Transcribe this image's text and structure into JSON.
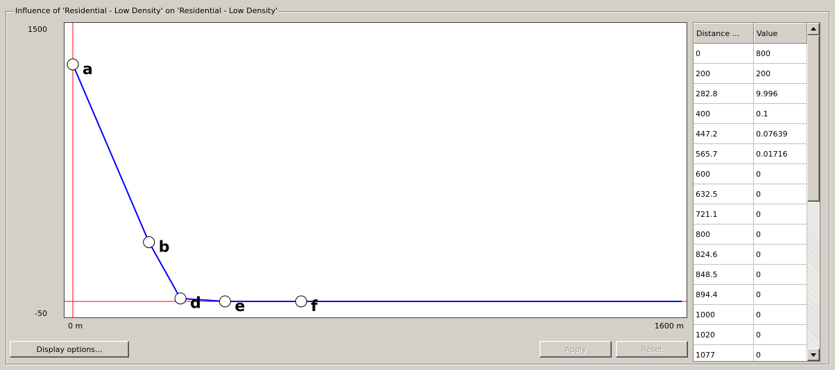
{
  "group_title": "Influence of 'Residential - Low Density' on 'Residential - Low Density'",
  "chart": {
    "y_max_label": "1500",
    "y_min_label": "-50",
    "x_min_label": "0 m",
    "x_max_label": "1600 m",
    "ylim": [
      -50,
      1500
    ],
    "xlim": [
      0,
      1600
    ],
    "line_color": "#0000ff",
    "axis_color": "#ff0000"
  },
  "chart_data": {
    "type": "line",
    "x": [
      0,
      200,
      282.8,
      400,
      600,
      1600
    ],
    "values": [
      800,
      200,
      9.996,
      0.1,
      0,
      0
    ],
    "point_labels": [
      "a",
      "b",
      "d",
      "e",
      "f"
    ],
    "ylim": [
      -50,
      1500
    ],
    "xlim": [
      0,
      1600
    ]
  },
  "buttons": {
    "display_options": "Display options...",
    "apply": "Apply",
    "reset": "Reset"
  },
  "table": {
    "headers": [
      "Distance ...",
      "Value"
    ],
    "rows": [
      [
        "0",
        "800"
      ],
      [
        "200",
        "200"
      ],
      [
        "282.8",
        "9.996"
      ],
      [
        "400",
        "0.1"
      ],
      [
        "447.2",
        "0.07639"
      ],
      [
        "565.7",
        "0.01716"
      ],
      [
        "600",
        "0"
      ],
      [
        "632.5",
        "0"
      ],
      [
        "721.1",
        "0"
      ],
      [
        "800",
        "0"
      ],
      [
        "824.6",
        "0"
      ],
      [
        "848.5",
        "0"
      ],
      [
        "894.4",
        "0"
      ],
      [
        "1000",
        "0"
      ],
      [
        "1020",
        "0"
      ],
      [
        "1077",
        "0"
      ]
    ]
  }
}
